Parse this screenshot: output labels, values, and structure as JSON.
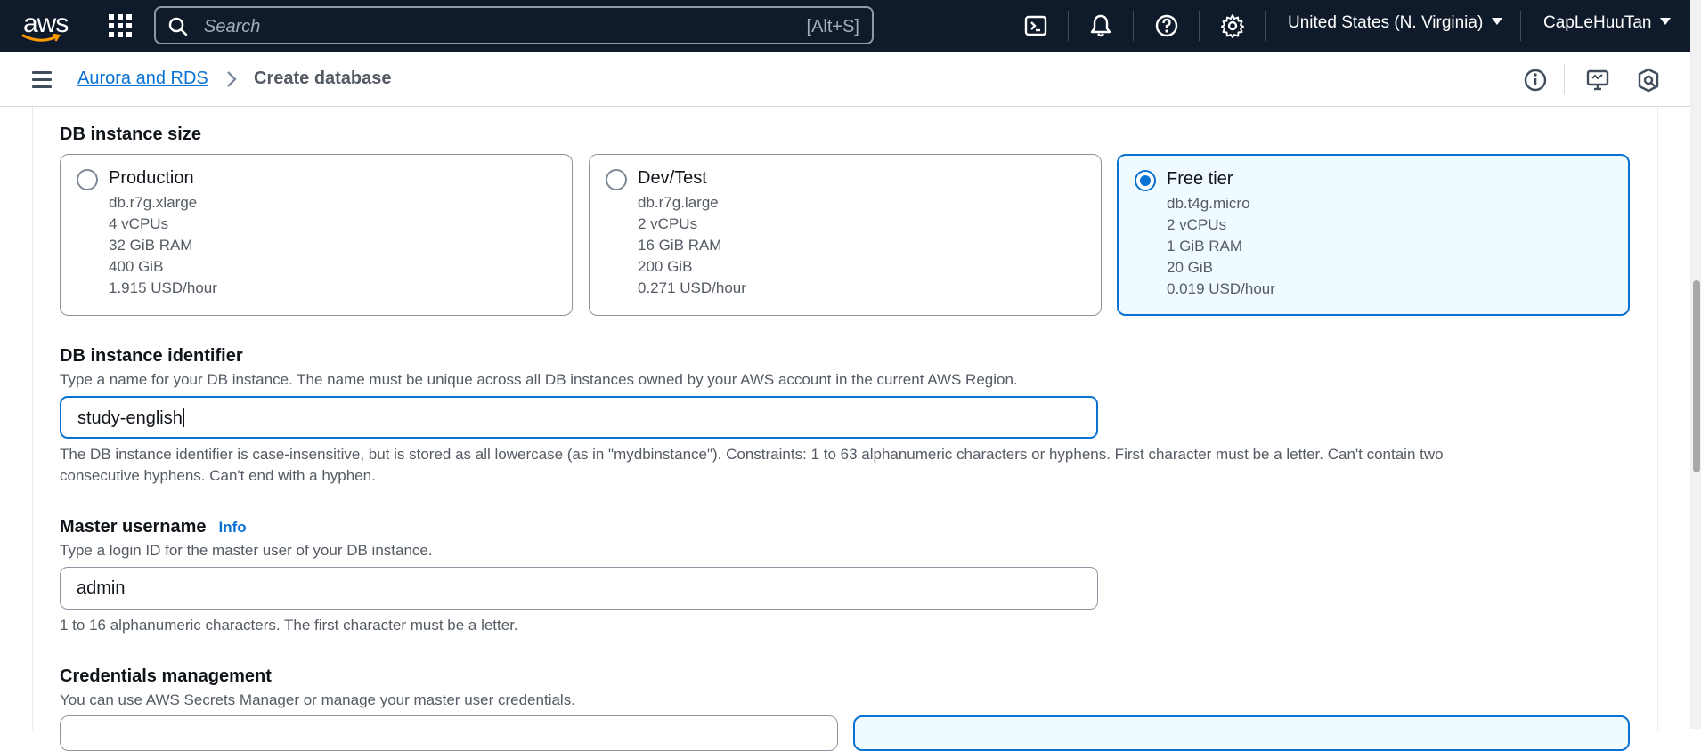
{
  "topnav": {
    "logo_text": "aws",
    "search_placeholder": "Search",
    "search_shortcut": "[Alt+S]",
    "region": "United States (N. Virginia)",
    "user": "CapLeHuuTan",
    "icons": [
      "cloudshell-icon",
      "bell-icon",
      "help-icon",
      "gear-icon"
    ]
  },
  "breadcrumb": {
    "parent": "Aurora and RDS",
    "current": "Create database"
  },
  "instance_size": {
    "label": "DB instance size",
    "options": [
      {
        "title": "Production",
        "lines": [
          "db.r7g.xlarge",
          "4 vCPUs",
          "32 GiB RAM",
          "400 GiB",
          "1.915 USD/hour"
        ],
        "selected": false
      },
      {
        "title": "Dev/Test",
        "lines": [
          "db.r7g.large",
          "2 vCPUs",
          "16 GiB RAM",
          "200 GiB",
          "0.271 USD/hour"
        ],
        "selected": false
      },
      {
        "title": "Free tier",
        "lines": [
          "db.t4g.micro",
          "2 vCPUs",
          "1 GiB RAM",
          "20 GiB",
          "0.019 USD/hour"
        ],
        "selected": true
      }
    ]
  },
  "identifier": {
    "label": "DB instance identifier",
    "description": "Type a name for your DB instance. The name must be unique across all DB instances owned by your AWS account in the current AWS Region.",
    "value": "study-english",
    "constraint_line1": "The DB instance identifier is case-insensitive, but is stored as all lowercase (as in \"mydbinstance\"). Constraints: 1 to 63 alphanumeric characters or hyphens. First character must be a letter. Can't contain two",
    "constraint_line2": "consecutive hyphens. Can't end with a hyphen."
  },
  "master_username": {
    "label": "Master username",
    "info": "Info",
    "description": "Type a login ID for the master user of your DB instance.",
    "value": "admin",
    "constraint": "1 to 16 alphanumeric characters. The first character must be a letter."
  },
  "credentials": {
    "label": "Credentials management",
    "description": "You can use AWS Secrets Manager or manage your master user credentials."
  },
  "colors": {
    "nav_bg": "#0f1b2a",
    "accent": "#0972d3",
    "selected_bg": "#f0fbff"
  }
}
